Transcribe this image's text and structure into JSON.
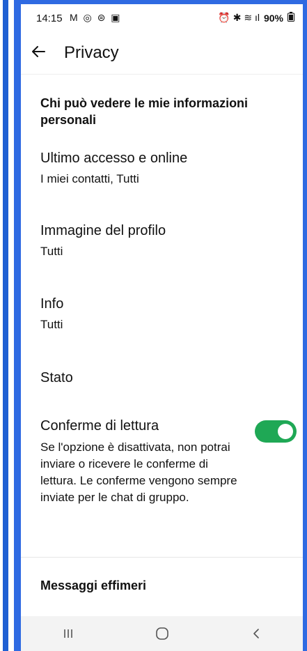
{
  "status": {
    "time": "14:15",
    "left_icons": "M ◎ ⊜ ▣",
    "right_icons": "⏰ ✱ ≋ ıl",
    "battery": "90%"
  },
  "appbar": {
    "title": "Privacy"
  },
  "section": {
    "header": "Chi può vedere le mie informazioni personali"
  },
  "items": [
    {
      "title": "Ultimo accesso e online",
      "value": "I miei contatti, Tutti"
    },
    {
      "title": "Immagine del profilo",
      "value": "Tutti"
    },
    {
      "title": "Info",
      "value": "Tutti"
    },
    {
      "title": "Stato",
      "value": ""
    }
  ],
  "read_receipts": {
    "title": "Conferme di lettura",
    "description": "Se l'opzione è disattivata, non potrai inviare o ricevere le conferme di lettura. Le conferme vengono sempre inviate per le chat di gruppo.",
    "enabled": true,
    "accent": "#1fa855"
  },
  "ephemeral": {
    "title": "Messaggi effimeri"
  },
  "navbar": {
    "recent": "recent-apps-icon",
    "home": "home-icon",
    "back": "back-icon"
  }
}
